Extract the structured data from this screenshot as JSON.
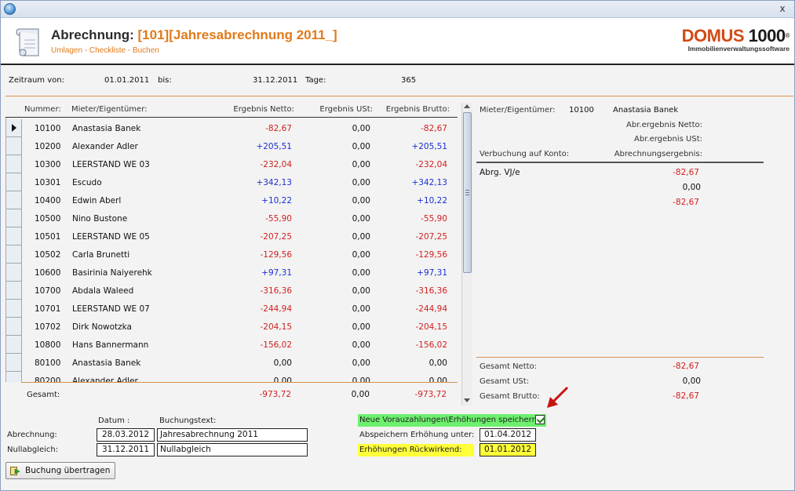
{
  "window": {
    "close_glyph": "x",
    "app_icon": "globe-icon"
  },
  "header": {
    "title_label": "Abrechnung:",
    "title_value": "[101][Jahresabrechnung 2011_]",
    "subtitle": "Umlagen - Checkliste - Buchen",
    "logo_brand": "DOMUS",
    "logo_number": "1000",
    "logo_reg": "®",
    "logo_tagline": "Immobilienverwaltungssoftware"
  },
  "period": {
    "from_label": "Zeitraum von:",
    "from_value": "01.01.2011",
    "to_label": "bis:",
    "to_value": "31.12.2011",
    "days_label": "Tage:",
    "days_value": "365"
  },
  "table": {
    "headers": {
      "number": "Nummer:",
      "tenant": "Mieter/Eigentümer:",
      "net": "Ergebnis Netto:",
      "tax": "Ergebnis USt:",
      "gross": "Ergebnis Brutto:"
    },
    "rows": [
      {
        "number": "10100",
        "name": "Anastasia Banek",
        "net": "-82,67",
        "tax": "0,00",
        "gross": "-82,67"
      },
      {
        "number": "10200",
        "name": "Alexander Adler",
        "net": "+205,51",
        "tax": "0,00",
        "gross": "+205,51"
      },
      {
        "number": "10300",
        "name": "LEERSTAND WE 03",
        "net": "-232,04",
        "tax": "0,00",
        "gross": "-232,04"
      },
      {
        "number": "10301",
        "name": "Escudo",
        "net": "+342,13",
        "tax": "0,00",
        "gross": "+342,13"
      },
      {
        "number": "10400",
        "name": "Edwin Aberl",
        "net": "+10,22",
        "tax": "0,00",
        "gross": "+10,22"
      },
      {
        "number": "10500",
        "name": "Nino Bustone",
        "net": "-55,90",
        "tax": "0,00",
        "gross": "-55,90"
      },
      {
        "number": "10501",
        "name": "LEERSTAND WE 05",
        "net": "-207,25",
        "tax": "0,00",
        "gross": "-207,25"
      },
      {
        "number": "10502",
        "name": "Carla Brunetti",
        "net": "-129,56",
        "tax": "0,00",
        "gross": "-129,56"
      },
      {
        "number": "10600",
        "name": "Basirinia Naiyerehk",
        "net": "+97,31",
        "tax": "0,00",
        "gross": "+97,31"
      },
      {
        "number": "10700",
        "name": "Abdala Waleed",
        "net": "-316,36",
        "tax": "0,00",
        "gross": "-316,36"
      },
      {
        "number": "10701",
        "name": "LEERSTAND WE 07",
        "net": "-244,94",
        "tax": "0,00",
        "gross": "-244,94"
      },
      {
        "number": "10702",
        "name": "Dirk Nowotzka",
        "net": "-204,15",
        "tax": "0,00",
        "gross": "-204,15"
      },
      {
        "number": "10800",
        "name": "Hans Bannermann",
        "net": "-156,02",
        "tax": "0,00",
        "gross": "-156,02"
      },
      {
        "number": "80100",
        "name": "Anastasia Banek",
        "net": "0,00",
        "tax": "0,00",
        "gross": "0,00"
      },
      {
        "number": "80200",
        "name": "Alexander Adler",
        "net": "0,00",
        "tax": "0,00",
        "gross": "0,00"
      }
    ],
    "total_label": "Gesamt:",
    "total_net": "-973,72",
    "total_tax": "0,00",
    "total_gross": "-973,72"
  },
  "detail": {
    "tenant_label": "Mieter/Eigentümer:",
    "tenant_number": "10100",
    "tenant_name": "Anastasia Banek",
    "net_label": "Abr.ergebnis Netto:",
    "tax_label": "Abr.ergebnis USt:",
    "account_label": "Verbuchung auf Konto:",
    "result_label": "Abrechnungsergebnis:",
    "entry_label": "Abrg. VJ/e",
    "entry_values": [
      "-82,67",
      "0,00",
      "-82,67"
    ],
    "total_net_label": "Gesamt Netto:",
    "total_net": "-82,67",
    "total_tax_label": "Gesamt USt:",
    "total_tax": "0,00",
    "total_gross_label": "Gesamt Brutto:",
    "total_gross": "-82,67"
  },
  "booking": {
    "date_header": "Datum :",
    "text_header": "Buchungstext:",
    "abrechnung_label": "Abrechnung:",
    "abrechnung_date": "28.03.2012",
    "abrechnung_text": "Jahresabrechnung 2011",
    "nullabgleich_label": "Nullabgleich:",
    "nullabgleich_date": "31.12.2011",
    "nullabgleich_text": "Nullabgleich",
    "save_prepayments_label": "Neue Vorauzahlungen\\Erhöhungen speichern",
    "save_prepayments_checked": true,
    "save_under_label": "Abspeichern Erhöhung unter:",
    "save_under_value": "01.04.2012",
    "retroactive_label": "Erhöhungen Rückwirkend:",
    "retroactive_value": "01.01.2012",
    "transfer_button": "Buchung übertragen"
  },
  "colors": {
    "accent": "#e07a1a",
    "negative": "#d21f1f",
    "positive": "#1d2fd0",
    "highlight_green": "#6ef06e",
    "highlight_yellow": "#ffff3a"
  }
}
